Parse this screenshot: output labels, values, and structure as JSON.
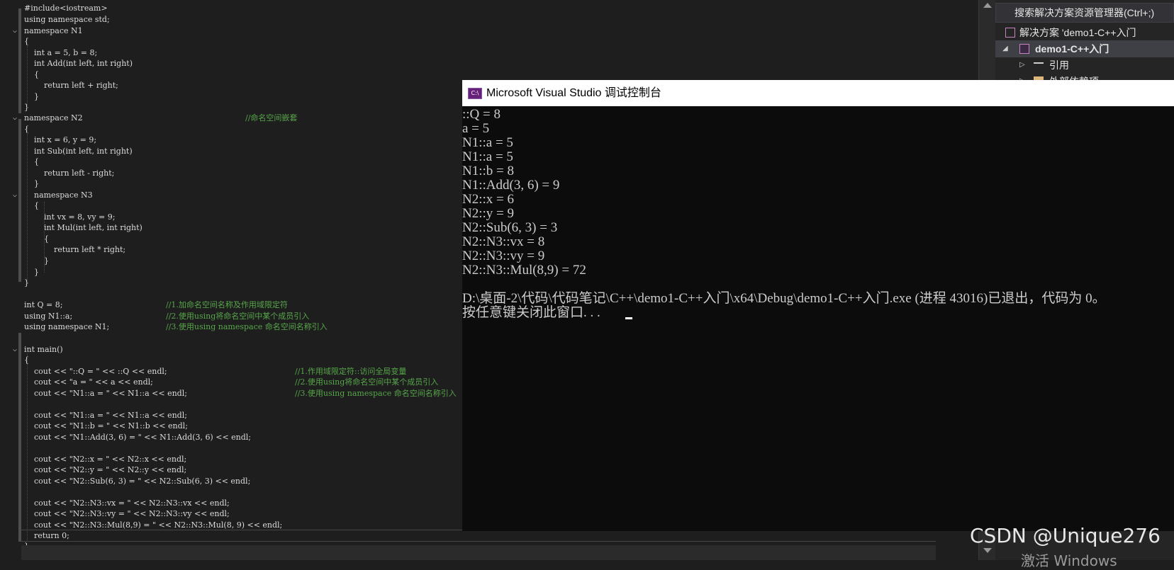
{
  "editor": {
    "lines": [
      {
        "code": "#include<iostream>",
        "comment": ""
      },
      {
        "code": "using namespace std;",
        "comment": ""
      },
      {
        "code": "namespace N1",
        "comment": ""
      },
      {
        "code": "{",
        "comment": ""
      },
      {
        "code": "    int a = 5, b = 8;",
        "comment": ""
      },
      {
        "code": "    int Add(int left, int right)",
        "comment": ""
      },
      {
        "code": "    {",
        "comment": ""
      },
      {
        "code": "        return left + right;",
        "comment": ""
      },
      {
        "code": "    }",
        "comment": ""
      },
      {
        "code": "}",
        "comment": ""
      },
      {
        "code": "namespace N2",
        "comment": "//命名空间嵌套"
      },
      {
        "code": "{",
        "comment": ""
      },
      {
        "code": "    int x = 6, y = 9;",
        "comment": ""
      },
      {
        "code": "    int Sub(int left, int right)",
        "comment": ""
      },
      {
        "code": "    {",
        "comment": ""
      },
      {
        "code": "        return left - right;",
        "comment": ""
      },
      {
        "code": "    }",
        "comment": ""
      },
      {
        "code": "    namespace N3",
        "comment": ""
      },
      {
        "code": "    {",
        "comment": ""
      },
      {
        "code": "        int vx = 8, vy = 9;",
        "comment": ""
      },
      {
        "code": "        int Mul(int left, int right)",
        "comment": ""
      },
      {
        "code": "        {",
        "comment": ""
      },
      {
        "code": "            return left * right;",
        "comment": ""
      },
      {
        "code": "        }",
        "comment": ""
      },
      {
        "code": "    }",
        "comment": ""
      },
      {
        "code": "}",
        "comment": ""
      },
      {
        "code": "",
        "comment": ""
      },
      {
        "code": "int Q = 8;",
        "comment": "//1.加命名空间名称及作用域限定符"
      },
      {
        "code": "using N1::a;",
        "comment": "//2.使用using将命名空间中某个成员引入"
      },
      {
        "code": "using namespace N1;",
        "comment": "//3.使用using namespace 命名空间名称引入"
      },
      {
        "code": "",
        "comment": ""
      },
      {
        "code": "int main()",
        "comment": ""
      },
      {
        "code": "{",
        "comment": ""
      },
      {
        "code": "    cout << \"::Q = \" << ::Q << endl;",
        "comment": "//1.作用域限定符::访问全局变量"
      },
      {
        "code": "    cout << \"a = \" << a << endl;",
        "comment": "//2.使用using将命名空间中某个成员引入"
      },
      {
        "code": "    cout << \"N1::a = \" << N1::a << endl;",
        "comment": "//3.使用using namespace 命名空间名称引入"
      },
      {
        "code": "",
        "comment": ""
      },
      {
        "code": "    cout << \"N1::a = \" << N1::a << endl;",
        "comment": ""
      },
      {
        "code": "    cout << \"N1::b = \" << N1::b << endl;",
        "comment": ""
      },
      {
        "code": "    cout << \"N1::Add(3, 6) = \" << N1::Add(3, 6) << endl;",
        "comment": ""
      },
      {
        "code": "",
        "comment": ""
      },
      {
        "code": "    cout << \"N2::x = \" << N2::x << endl;",
        "comment": ""
      },
      {
        "code": "    cout << \"N2::y = \" << N2::y << endl;",
        "comment": ""
      },
      {
        "code": "    cout << \"N2::Sub(6, 3) = \" << N2::Sub(6, 3) << endl;",
        "comment": ""
      },
      {
        "code": "",
        "comment": ""
      },
      {
        "code": "    cout << \"N2::N3::vx = \" << N2::N3::vx << endl;",
        "comment": ""
      },
      {
        "code": "    cout << \"N2::N3::vy = \" << N2::N3::vy << endl;",
        "comment": ""
      },
      {
        "code": "    cout << \"N2::N3::Mul(8,9) = \" << N2::N3::Mul(8, 9) << endl;",
        "comment": ""
      },
      {
        "code": "    return 0;",
        "comment": ""
      },
      {
        "code": "}",
        "comment": ""
      }
    ]
  },
  "solution_explorer": {
    "search_placeholder": "搜索解决方案资源管理器(Ctrl+;)",
    "items": [
      {
        "label": "解决方案 'demo1-C++入门",
        "icon": "solution-icon"
      },
      {
        "label": "demo1-C++入门",
        "icon": "cpp-project-icon"
      },
      {
        "label": "引用",
        "icon": "references-icon"
      },
      {
        "label": "外部依赖项",
        "icon": "folder-icon"
      }
    ]
  },
  "console": {
    "title": "Microsoft Visual Studio 调试控制台",
    "icon_text": "C:\\",
    "lines": [
      "::Q = 8",
      "a = 5",
      "N1::a = 5",
      "N1::a = 5",
      "N1::b = 8",
      "N1::Add(3, 6) = 9",
      "N2::x = 6",
      "N2::y = 9",
      "N2::Sub(6, 3) = 3",
      "N2::N3::vx = 8",
      "N2::N3::vy = 9",
      "N2::N3::Mul(8,9) = 72",
      "",
      "D:\\桌面-2\\代码\\代码笔记\\C++\\demo1-C++入门\\x64\\Debug\\demo1-C++入门.exe (进程 43016)已退出，代码为 0。",
      "按任意键关闭此窗口. . ."
    ]
  },
  "watermark": {
    "text": "CSDN @Unique276",
    "activate_text": "激活 Windows"
  }
}
